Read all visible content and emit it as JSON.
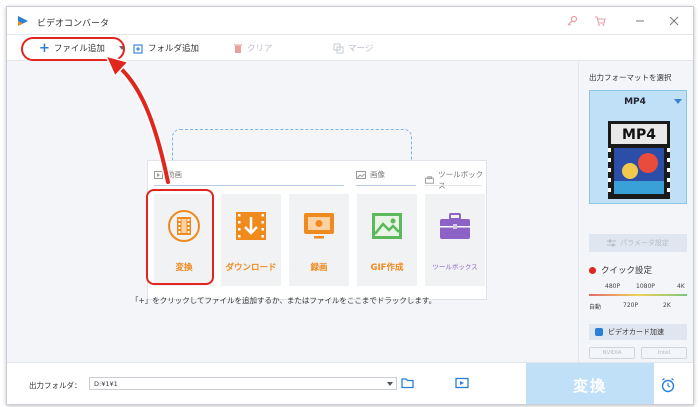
{
  "app": {
    "title": "ビデオコンバータ"
  },
  "toolbar": {
    "add_file": "ファイル追加",
    "add_folder": "フォルダ追加",
    "clear": "クリア",
    "merge": "マージ"
  },
  "categories": {
    "video": "動画",
    "image": "画像",
    "tools": "ツールボックス"
  },
  "cards": [
    {
      "label": "変換",
      "icon": "film-convert-icon"
    },
    {
      "label": "ダウンロード",
      "icon": "download-icon"
    },
    {
      "label": "録画",
      "icon": "screen-record-icon"
    },
    {
      "label": "GIF作成",
      "icon": "image-gif-icon"
    },
    {
      "label": "ツールボックス",
      "icon": "toolbox-icon"
    }
  ],
  "hint": "「+」をクリックしてファイルを追加するか、またはファイルをここまでドラックします。",
  "right_panel": {
    "title": "出力フォーマットを選択",
    "format": "MP4",
    "format_badge": "MP4",
    "params_button": "パラメータ設定",
    "quick_settings": "クイック設定",
    "quality_top": [
      "480P",
      "1080P",
      "4K"
    ],
    "quality_bottom": [
      "自動",
      "720P",
      "2K"
    ],
    "gpu_accel": "ビデオカード加速",
    "vendors": [
      "NVIDIA",
      "Intel"
    ]
  },
  "bottom": {
    "output_label": "出力フォルダ：",
    "output_path": "D:¥1¥1",
    "convert": "変換"
  },
  "colors": {
    "accent_blue": "#2a7fd8",
    "highlight_red": "#e0261d",
    "card_orange": "#f08a1d",
    "card_purple": "#8d62c6",
    "format_bg": "#bfe0f6"
  }
}
